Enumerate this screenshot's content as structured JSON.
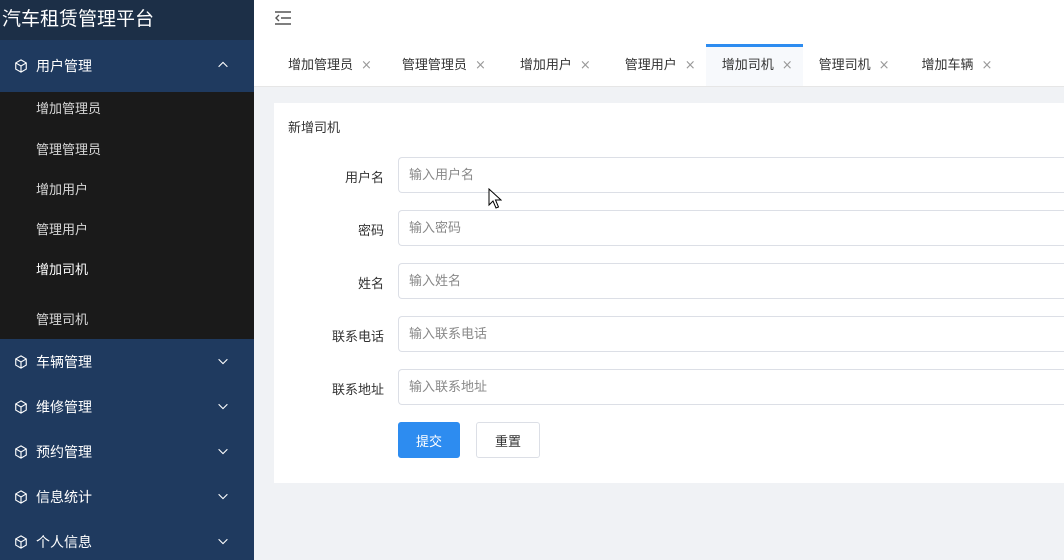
{
  "app": {
    "title": "汽车租赁管理平台"
  },
  "sidebar": {
    "groups": [
      {
        "label": "用户管理",
        "items": [
          "增加管理员",
          "管理管理员",
          "增加用户",
          "管理用户",
          "增加司机",
          "管理司机"
        ],
        "active_item": "增加司机"
      },
      {
        "label": "车辆管理"
      },
      {
        "label": "维修管理"
      },
      {
        "label": "预约管理"
      },
      {
        "label": "信息统计"
      },
      {
        "label": "个人信息"
      }
    ]
  },
  "tabs": [
    {
      "label": "增加管理员",
      "close": "×"
    },
    {
      "label": "管理管理员",
      "close": "×"
    },
    {
      "label": "增加用户",
      "close": "×"
    },
    {
      "label": "管理用户",
      "close": "×"
    },
    {
      "label": "增加司机",
      "close": "×"
    },
    {
      "label": "管理司机",
      "close": "×"
    },
    {
      "label": "增加车辆",
      "close": "×"
    }
  ],
  "form": {
    "title": "新增司机",
    "fields": [
      {
        "label": "用户名",
        "placeholder": "输入用户名",
        "value": ""
      },
      {
        "label": "密码",
        "placeholder": "输入密码",
        "value": ""
      },
      {
        "label": "姓名",
        "placeholder": "输入姓名",
        "value": ""
      },
      {
        "label": "联系电话",
        "placeholder": "输入联系电话",
        "value": ""
      },
      {
        "label": "联系地址",
        "placeholder": "输入联系地址",
        "value": ""
      }
    ],
    "submit_label": "提交",
    "reset_label": "重置"
  },
  "colors": {
    "sidebar_bg": "#1f3a5f",
    "submenu_bg": "#1a1a1a",
    "accent": "#2d8cf0"
  },
  "icons": {
    "group_icon": "cube-icon",
    "collapse": "menu-fold-icon"
  }
}
